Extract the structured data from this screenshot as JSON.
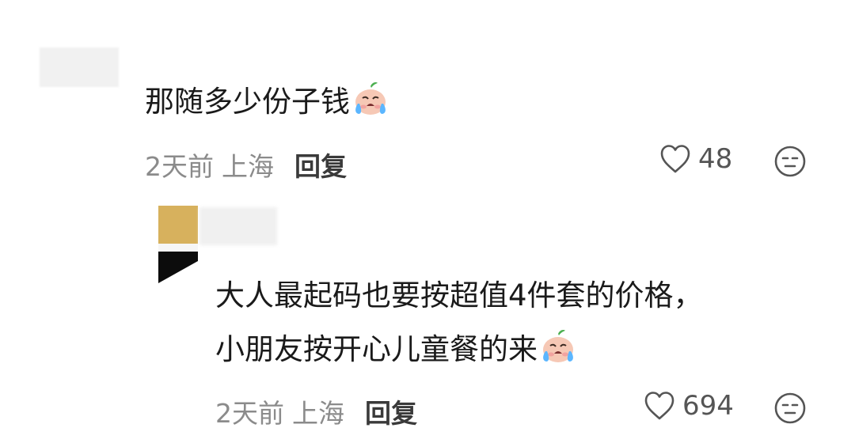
{
  "comment": {
    "text": "那随多少份子钱",
    "emoji": "crying-face-emoji",
    "time": "2天前",
    "location": "上海",
    "reply_label": "回复",
    "likes": "48"
  },
  "reply": {
    "line1": "大人最起码也要按超值4件套的价格，",
    "line2": "小朋友按开心儿童餐的来",
    "emoji": "crying-face-emoji",
    "time": "2天前",
    "location": "上海",
    "reply_label": "回复",
    "likes": "694"
  },
  "icons": {
    "like": "heart-outline-icon",
    "dislike": "unamused-face-icon"
  },
  "colors": {
    "text": "#1a1a1a",
    "meta": "#8b8b8b",
    "reply_button": "#3a3a3a",
    "avatar_gold": "#d7b15d",
    "avatar_black": "#0c0c0c"
  }
}
